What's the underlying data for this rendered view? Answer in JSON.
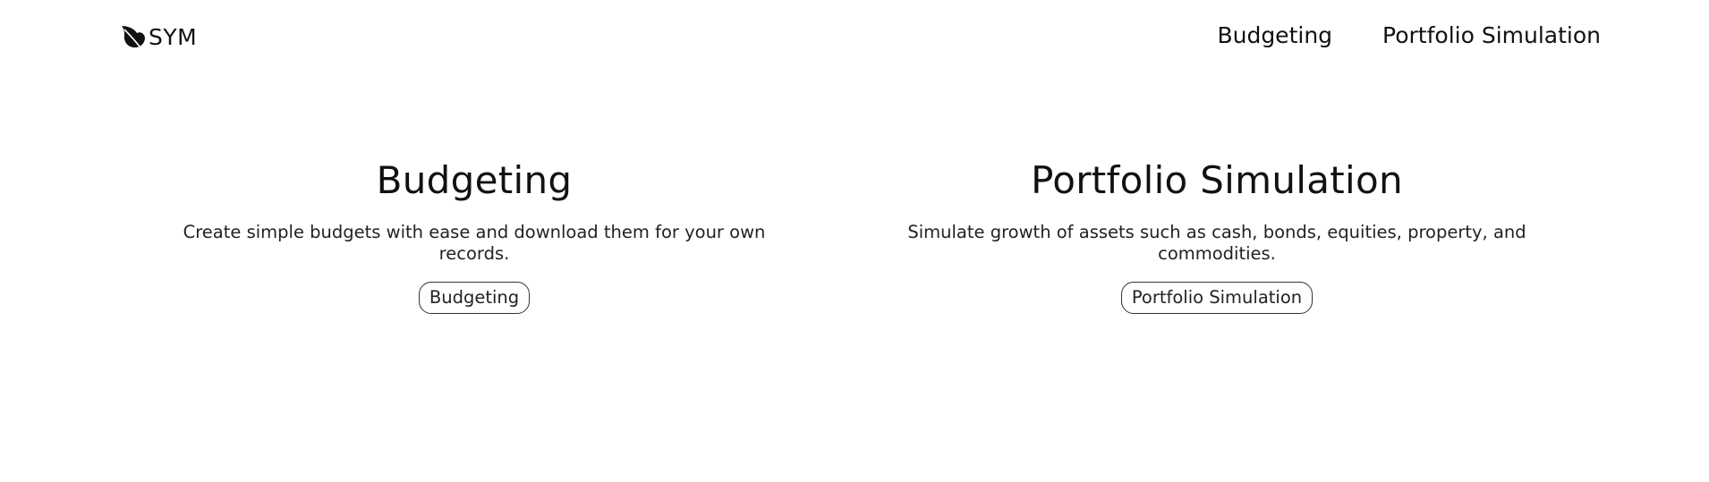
{
  "header": {
    "brand": {
      "name": "SYM",
      "icon": "leaf-icon"
    },
    "nav": [
      {
        "label": "Budgeting"
      },
      {
        "label": "Portfolio Simulation"
      }
    ]
  },
  "features": [
    {
      "title": "Budgeting",
      "description": "Create simple budgets with ease and download them for your own records.",
      "button_label": "Budgeting"
    },
    {
      "title": "Portfolio Simulation",
      "description": "Simulate growth of assets such as cash, bonds, equities, property, and commodities.",
      "button_label": "Portfolio Simulation"
    }
  ],
  "colors": {
    "text": "#111111",
    "background": "#ffffff",
    "button_border": "#333333"
  }
}
